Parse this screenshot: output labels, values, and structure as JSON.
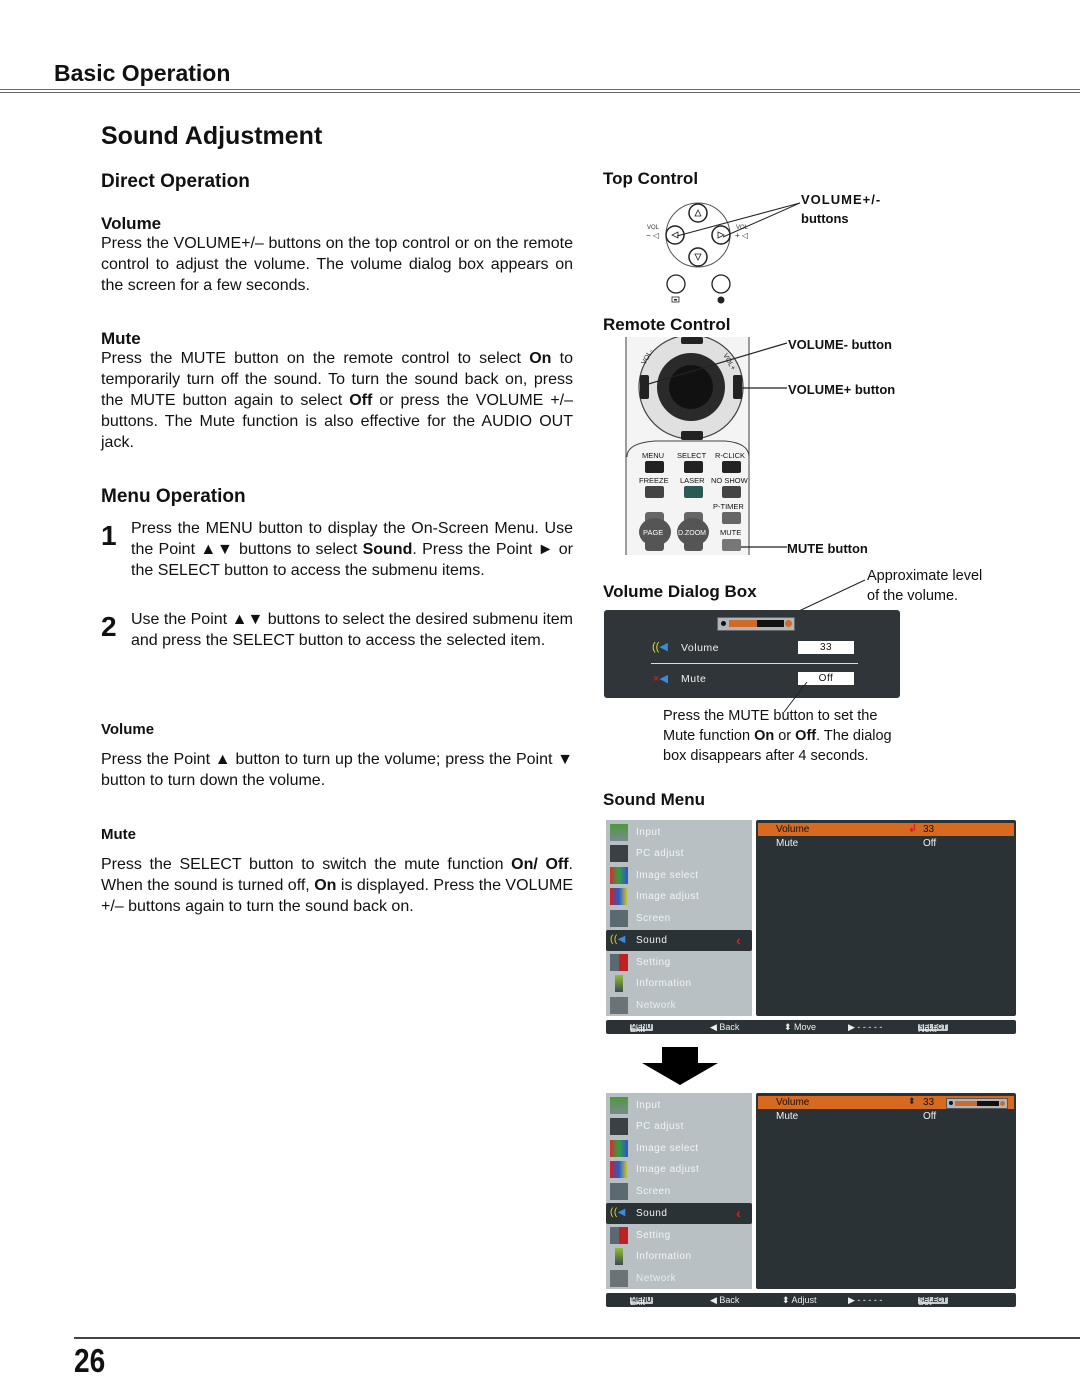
{
  "header": {
    "section": "Basic Operation",
    "title": "Sound Adjustment"
  },
  "left": {
    "direct_operation": {
      "heading": "Direct Operation",
      "volume": {
        "heading": "Volume",
        "text": "Press the VOLUME+/– buttons on the top control or on the remote control to adjust the volume. The volume dialog box appears on the screen for a few seconds."
      },
      "mute": {
        "heading": "Mute",
        "text_1": "Press the MUTE button on the remote control to select ",
        "bold_1": "On",
        "text_2": " to temporarily turn off the sound. To turn the sound back on, press the MUTE button again to select ",
        "bold_2": "Off",
        "text_3": " or press the VOLUME +/– buttons. The Mute function is also effective for the AUDIO OUT jack."
      }
    },
    "menu_operation": {
      "heading": "Menu Operation",
      "steps": [
        {
          "number": "1",
          "text_1": "Press the MENU button to display the On-Screen Menu. Use the Point ▲▼ buttons to select ",
          "bold": "Sound",
          "text_2": ". Press the Point ► or the SELECT button to access the submenu items."
        },
        {
          "number": "2",
          "text": "Use the Point ▲▼ buttons to select the desired submenu item and press the SELECT button to access the selected item."
        }
      ],
      "volume": {
        "heading": "Volume",
        "text": "Press the Point ▲ button to turn up the volume; press the Point ▼ button to turn down the volume."
      },
      "mute": {
        "heading": "Mute",
        "text_1": "Press the SELECT button to switch the mute function ",
        "bold_1": "On/ Off",
        "text_2": ". When the sound is turned off, ",
        "bold_2": "On",
        "text_3": " is displayed. Press the VOLUME +/– buttons again to turn the sound back on."
      }
    }
  },
  "right": {
    "top_control": {
      "heading": "Top Control",
      "callout_line1": "VOLUME+/-",
      "callout_line2": "buttons",
      "vol_label_left": "VOL",
      "vol_label_right": "VOL",
      "minus": "−",
      "plus": "+"
    },
    "remote_control": {
      "heading": "Remote Control",
      "callouts": [
        "VOLUME- button",
        "VOLUME+ button",
        "MUTE button"
      ],
      "button_labels": [
        "MENU",
        "SELECT",
        "R-CLICK",
        "FREEZE",
        "LASER",
        "NO SHOW",
        "P-TIMER",
        "PAGE",
        "D.ZOOM",
        "MUTE"
      ],
      "ring_labels": [
        "VOL-",
        "VOL+"
      ]
    },
    "volume_dialog": {
      "heading": "Volume Dialog Box",
      "callout_level_1": "Approximate level",
      "callout_level_2": "of the volume.",
      "volume_label": "Volume",
      "volume_value": "33",
      "volume_level_fraction": 0.5,
      "mute_label": "Mute",
      "mute_value": "Off",
      "note_1": "Press the MUTE button to set the",
      "note_2a": "Mute function ",
      "note_on": "On",
      "note_or": " or ",
      "note_off": "Off",
      "note_2b": ". The dialog",
      "note_3": "box disappears after 4 seconds."
    },
    "sound_menu": {
      "heading": "Sound Menu",
      "menu_items": [
        "Input",
        "PC adjust",
        "Image select",
        "Image adjust",
        "Screen",
        "Sound",
        "Setting",
        "Information",
        "Network"
      ],
      "selected_item": "Sound",
      "submenu": [
        {
          "name": "Volume",
          "value": "33"
        },
        {
          "name": "Mute",
          "value": "Off"
        }
      ],
      "footer_1": {
        "menu_key": "MENU",
        "exit": "Exit",
        "back": "◀ Back",
        "move": "⬍ Move",
        "next_dashes": "▶ - - - - -",
        "select_key": "SELECT",
        "next": "Next"
      },
      "footer_2": {
        "menu_key": "MENU",
        "exit": "Exit",
        "back": "◀ Back",
        "move": "⬍ Adjust",
        "next_dashes": "▶ - - - - -",
        "select_key": "SELECT",
        "next": "Set"
      },
      "volume_level_fraction": 0.5
    }
  },
  "footer": {
    "page_number": "26"
  },
  "colors": {
    "osd_dark": "#2b3236",
    "osd_light": "#b8c0c4",
    "highlight_orange": "#d86a20",
    "selector_red": "#e02020"
  }
}
